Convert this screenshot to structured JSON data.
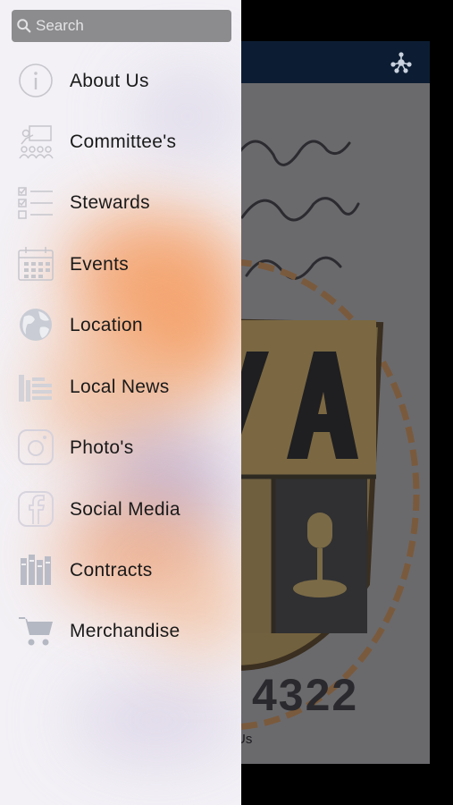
{
  "search": {
    "placeholder": "Search"
  },
  "menu": [
    {
      "label": "About Us",
      "icon": "info-icon"
    },
    {
      "label": "Committee's",
      "icon": "presentation-icon"
    },
    {
      "label": "Stewards",
      "icon": "checklist-icon"
    },
    {
      "label": "Events",
      "icon": "calendar-icon"
    },
    {
      "label": "Location",
      "icon": "globe-icon"
    },
    {
      "label": "Local News",
      "icon": "news-icon"
    },
    {
      "label": "Photo's",
      "icon": "camera-icon"
    },
    {
      "label": "Social Media",
      "icon": "social-icon"
    },
    {
      "label": "Contracts",
      "icon": "books-icon"
    },
    {
      "label": "Merchandise",
      "icon": "cart-icon"
    }
  ],
  "background": {
    "number": "4322",
    "caption": "Us"
  }
}
